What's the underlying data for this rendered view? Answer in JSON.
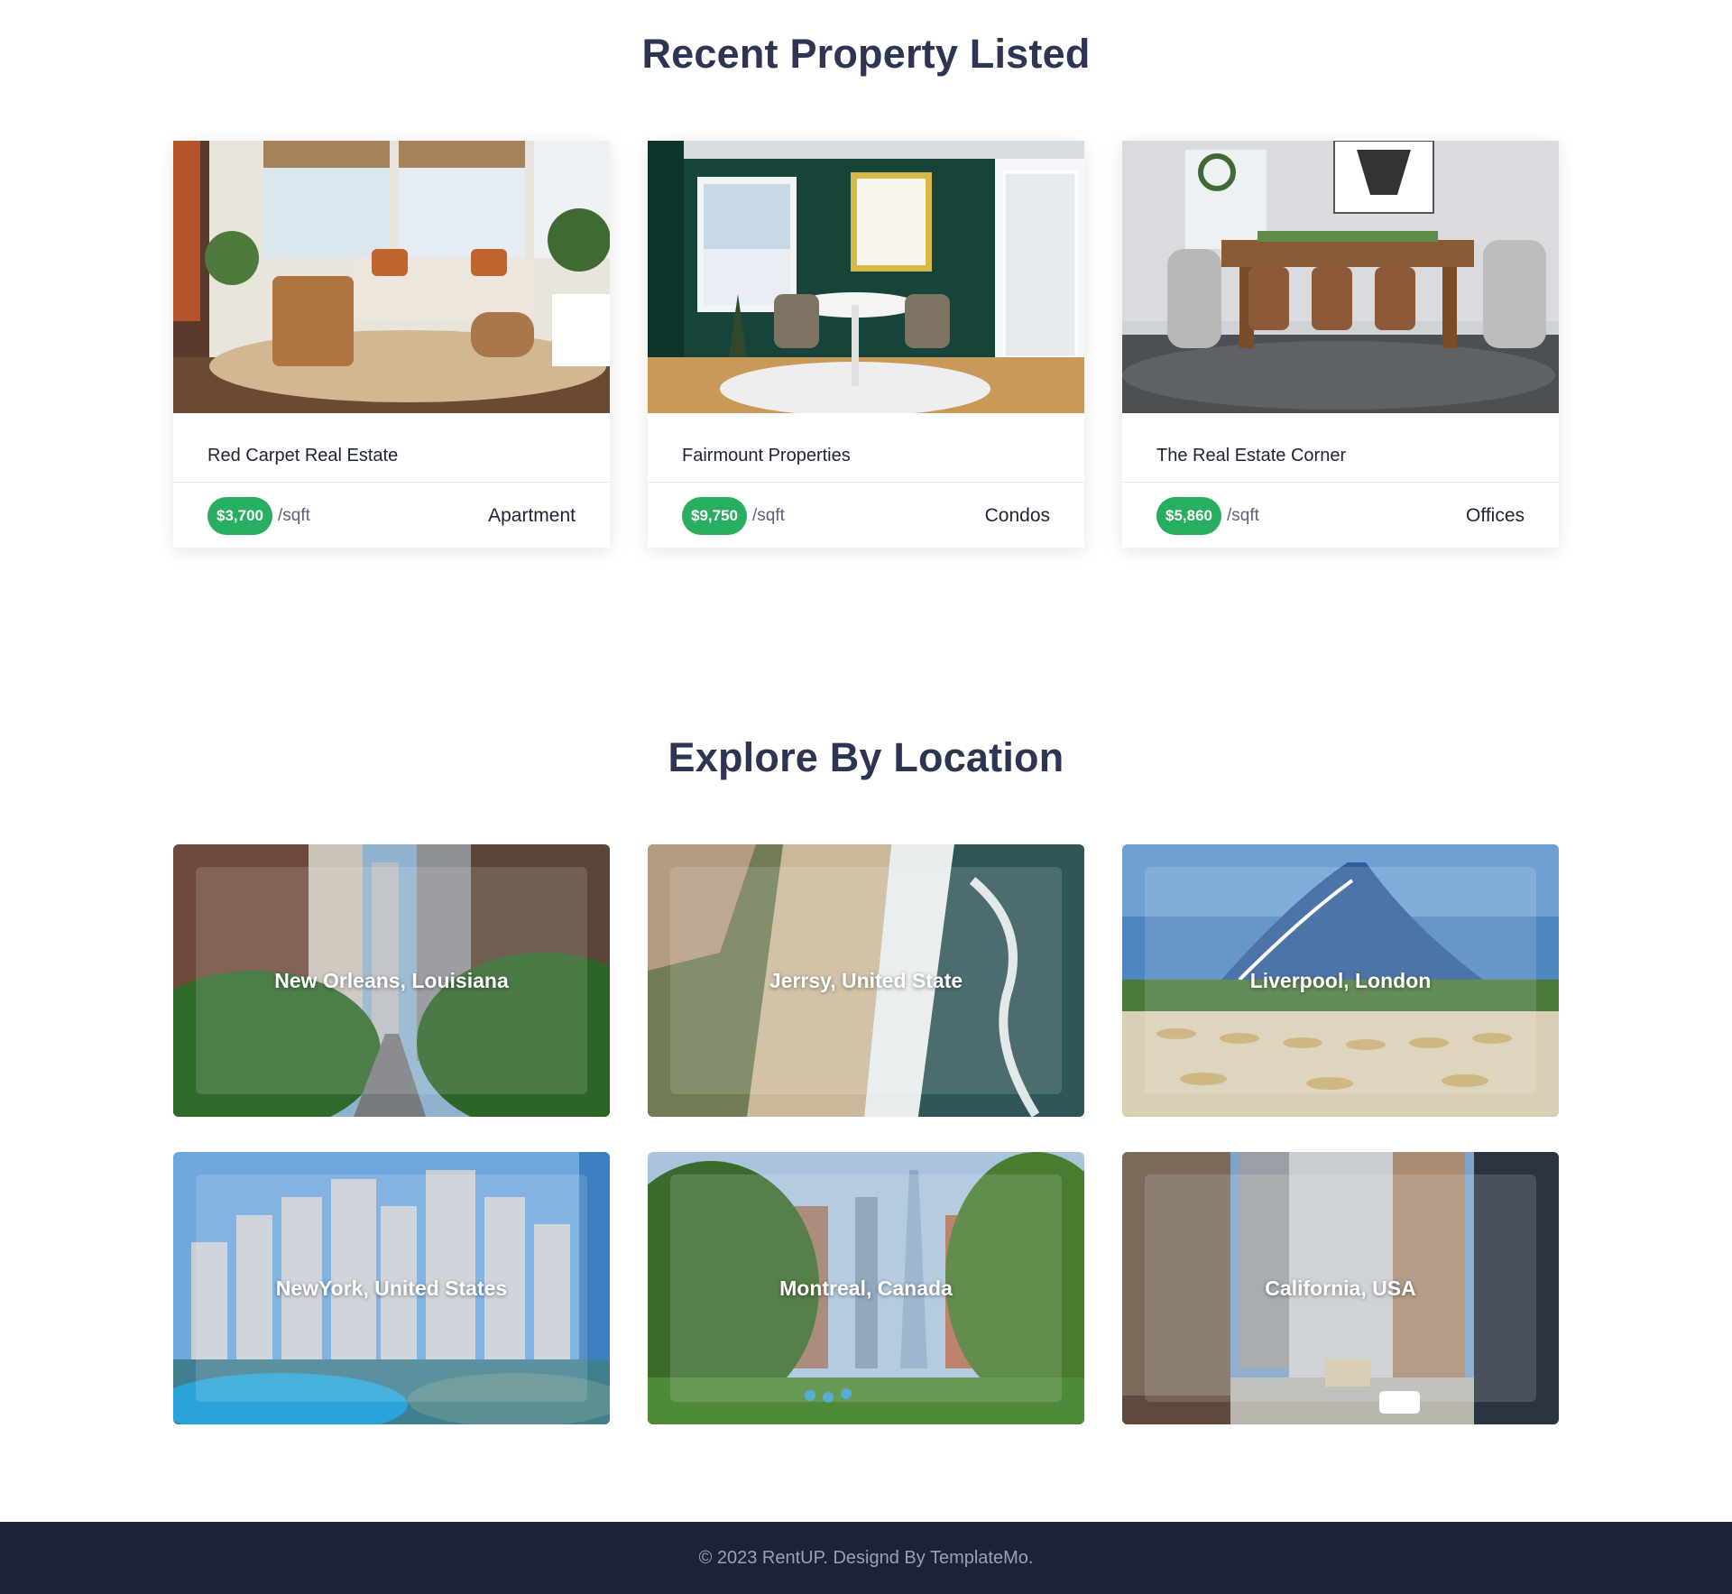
{
  "recent": {
    "title": "Recent Property Listed",
    "cards": [
      {
        "name": "Red Carpet Real Estate",
        "price": "$3,700",
        "unit": "/sqft",
        "type": "Apartment",
        "image": "living-room-photo"
      },
      {
        "name": "Fairmount Properties",
        "price": "$9,750",
        "unit": "/sqft",
        "type": "Condos",
        "image": "green-dining-room-photo"
      },
      {
        "name": "The Real Estate Corner",
        "price": "$5,860",
        "unit": "/sqft",
        "type": "Offices",
        "image": "dining-table-photo"
      }
    ]
  },
  "explore": {
    "title": "Explore By Location",
    "locations": [
      {
        "label": "New Orleans, Louisiana",
        "image": "city-street-photo"
      },
      {
        "label": "Jerrsy, United State",
        "image": "beach-aerial-photo"
      },
      {
        "label": "Liverpool, London",
        "image": "beach-hotel-photo"
      },
      {
        "label": "NewYork, United States",
        "image": "marina-skyline-photo"
      },
      {
        "label": "Montreal, Canada",
        "image": "park-skyline-photo"
      },
      {
        "label": "California, USA",
        "image": "avenue-buildings-photo"
      }
    ]
  },
  "footer": {
    "text": "© 2023 RentUP. Designd By TemplateMo."
  },
  "colors": {
    "accent": "#27ae60",
    "heading": "#2c3552",
    "footer_bg": "#1c2338"
  }
}
